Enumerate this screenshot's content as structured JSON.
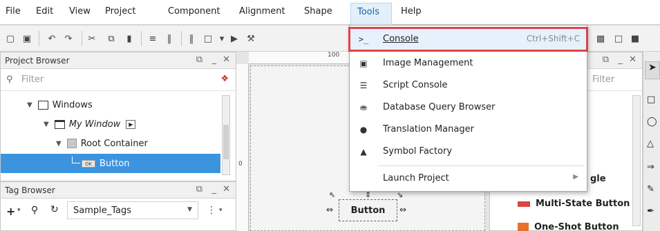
{
  "menubar": {
    "items": [
      "File",
      "Edit",
      "View",
      "Project",
      "Component",
      "Alignment",
      "Shape",
      "Tools",
      "Help"
    ],
    "accent": "#1a5fa8"
  },
  "project_browser": {
    "title": "Project Browser",
    "filter_placeholder": "Filter",
    "tree": [
      {
        "label": "Windows"
      },
      {
        "label": "My Window"
      },
      {
        "label": "Root Container"
      },
      {
        "label": "Button"
      }
    ]
  },
  "tag_browser": {
    "title": "Tag Browser",
    "provider": "Sample_Tags"
  },
  "canvas": {
    "ruler_h_label": "100",
    "ruler_v_label": "0",
    "selected_component": "Button"
  },
  "palette": {
    "filter_placeholder": "Filter",
    "items": [
      "gle",
      "Multi-State Button",
      "One-Shot Button"
    ]
  },
  "tools_menu": {
    "items": [
      {
        "label": "Console",
        "shortcut": "Ctrl+Shift+C",
        "icon": "console-icon",
        "highlighted": true
      },
      {
        "label": "Image Management",
        "icon": "image-icon"
      },
      {
        "label": "Script Console",
        "icon": "script-console-icon"
      },
      {
        "label": "Database Query Browser",
        "icon": "database-icon"
      },
      {
        "label": "Translation Manager",
        "icon": "globe-icon"
      },
      {
        "label": "Symbol Factory",
        "icon": "symbol-factory-icon"
      },
      {
        "label": "Launch Project",
        "icon": "",
        "submenu": true
      }
    ],
    "highlight_color": "#e0414a"
  }
}
